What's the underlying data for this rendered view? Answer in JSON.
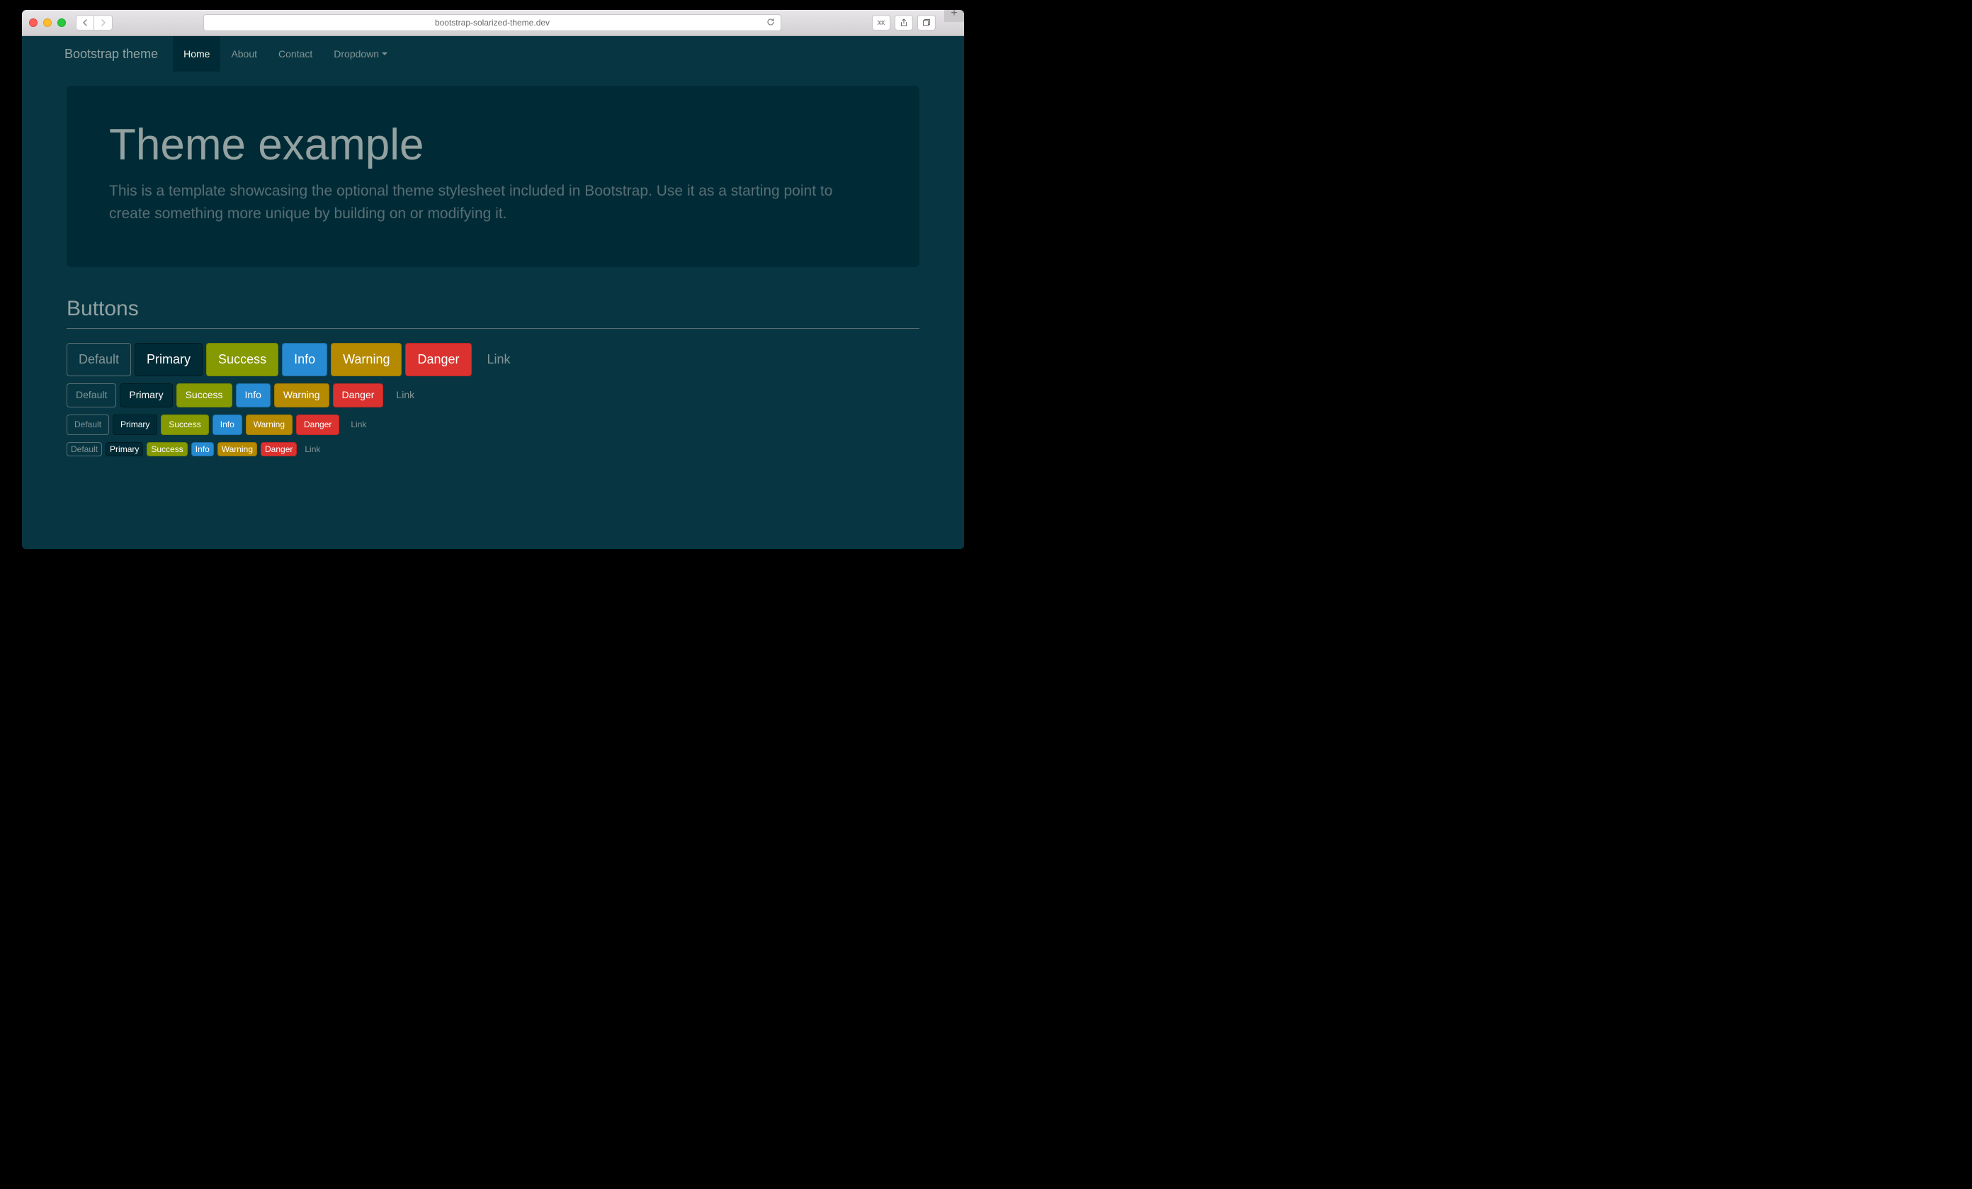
{
  "browser": {
    "url": "bootstrap-solarized-theme.dev"
  },
  "navbar": {
    "brand": "Bootstrap theme",
    "items": [
      {
        "label": "Home"
      },
      {
        "label": "About"
      },
      {
        "label": "Contact"
      },
      {
        "label": "Dropdown"
      }
    ]
  },
  "jumbotron": {
    "title": "Theme example",
    "lead": "This is a template showcasing the optional theme stylesheet included in Bootstrap. Use it as a starting point to create something more unique by building on or modifying it."
  },
  "buttons_section": {
    "heading": "Buttons",
    "labels": {
      "default": "Default",
      "primary": "Primary",
      "success": "Success",
      "info": "Info",
      "warning": "Warning",
      "danger": "Danger",
      "link": "Link"
    }
  }
}
